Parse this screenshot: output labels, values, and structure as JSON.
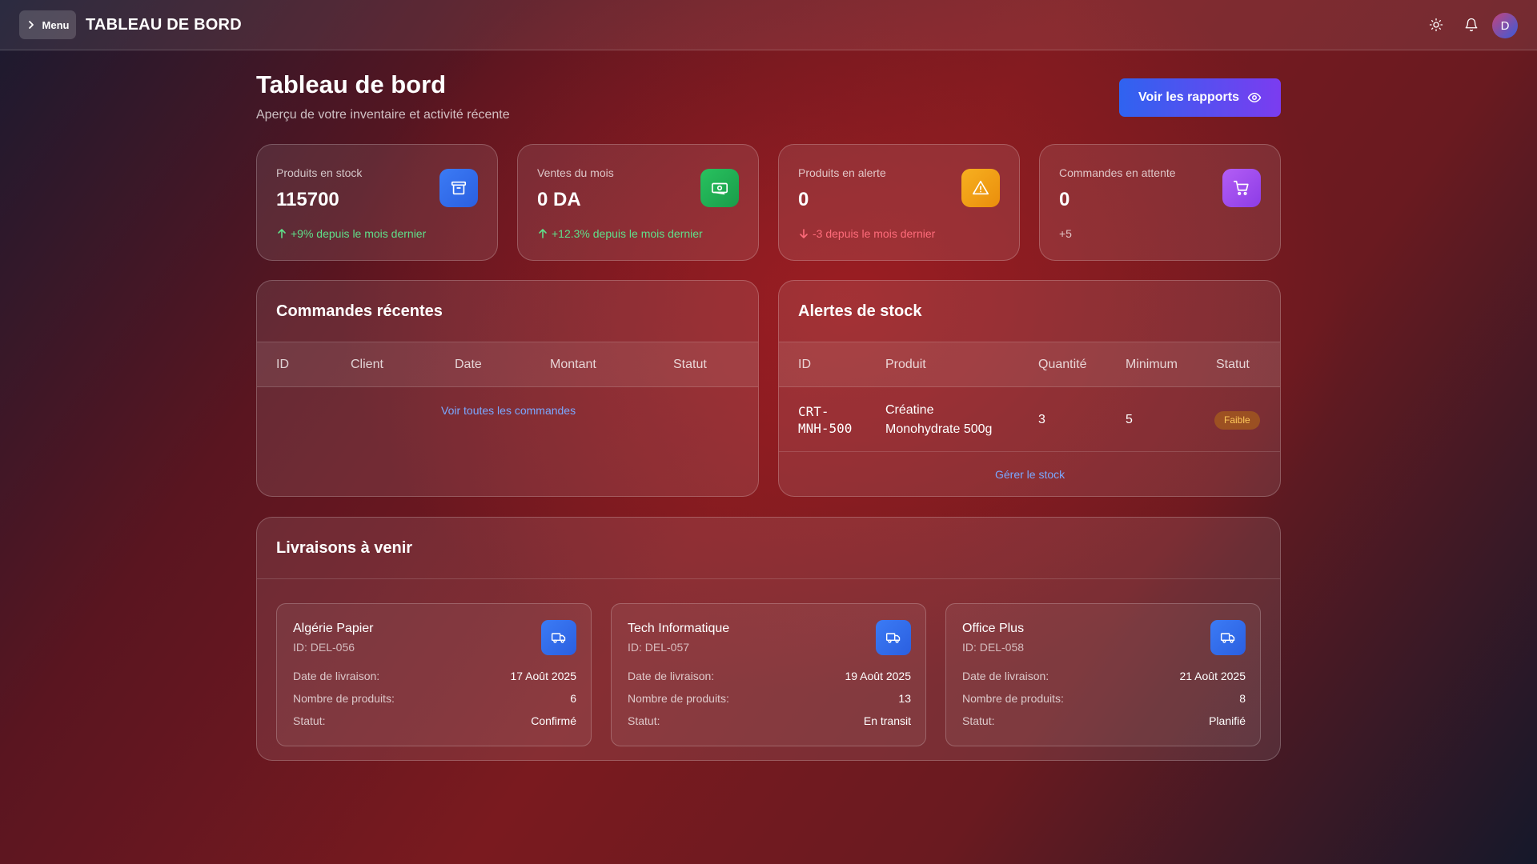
{
  "topbar": {
    "menu_label": "Menu",
    "title": "TABLEAU DE BORD",
    "avatar_initial": "D"
  },
  "header": {
    "title": "Tableau de bord",
    "subtitle": "Aperçu de votre inventaire et activité récente",
    "reports_button": "Voir les rapports"
  },
  "stats": [
    {
      "label": "Produits en stock",
      "value": "115700",
      "trend": "+9% depuis le mois dernier",
      "icon": "archive-icon",
      "color": "#3b7bf5"
    },
    {
      "label": "Ventes du mois",
      "value": "0 DA",
      "trend": "+12.3% depuis le mois dernier",
      "icon": "money-icon",
      "color": "#22b457"
    },
    {
      "label": "Produits en alerte",
      "value": "0",
      "trend": "-3 depuis le mois dernier",
      "icon": "warning-icon",
      "color": "#f2a516"
    },
    {
      "label": "Commandes en attente",
      "value": "0",
      "trend": "+5",
      "icon": "cart-icon",
      "color": "#a651f0"
    }
  ],
  "orders": {
    "title": "Commandes récentes",
    "columns": [
      "ID",
      "Client",
      "Date",
      "Montant",
      "Statut"
    ],
    "link": "Voir toutes les commandes"
  },
  "alerts": {
    "title": "Alertes de stock",
    "columns": [
      "ID",
      "Produit",
      "Quantité",
      "Minimum",
      "Statut"
    ],
    "rows": [
      {
        "id_line1": "CRT-",
        "id_line2": "MNH-500",
        "product_line1": "Créatine",
        "product_line2": "Monohydrate 500g",
        "quantity": "3",
        "minimum": "5",
        "status": "Faible"
      }
    ],
    "link": "Gérer le stock"
  },
  "deliveries": {
    "title": "Livraisons à venir",
    "items": [
      {
        "name": "Algérie Papier",
        "id": "ID: DEL-056",
        "date_label": "Date de livraison:",
        "date": "17 Août 2025",
        "count_label": "Nombre de produits:",
        "count": "6",
        "status_label": "Statut:",
        "status": "Confirmé"
      },
      {
        "name": "Tech Informatique",
        "id": "ID: DEL-057",
        "date_label": "Date de livraison:",
        "date": "19 Août 2025",
        "count_label": "Nombre de produits:",
        "count": "13",
        "status_label": "Statut:",
        "status": "En transit"
      },
      {
        "name": "Office Plus",
        "id": "ID: DEL-058",
        "date_label": "Date de livraison:",
        "date": "21 Août 2025",
        "count_label": "Nombre de produits:",
        "count": "8",
        "status_label": "Statut:",
        "status": "Planifié"
      }
    ]
  }
}
